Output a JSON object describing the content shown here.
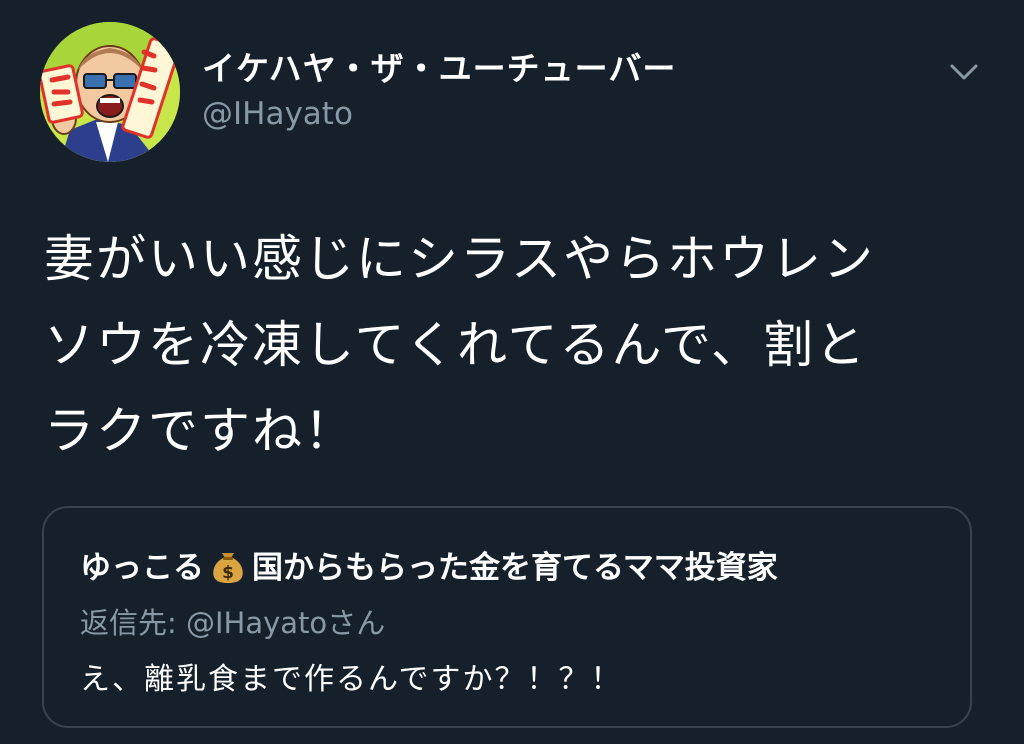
{
  "author": {
    "display_name": "イケハヤ・ザ・ユーチューバー",
    "username": "@IHayato",
    "avatar_text": "イケハヤ大学"
  },
  "tweet": {
    "text": "妻がいい感じにシラスやらホウレン\nソウを冷凍してくれてるんで、割と\nラクですね！"
  },
  "quoted_tweet": {
    "author_name_part1": "ゆっこる",
    "author_emoji": "money-bag-icon",
    "author_name_part2": "国からもらった金を育てるママ投資家",
    "reply_label": "返信先: ",
    "reply_username": "@IHayato",
    "reply_suffix": "さん",
    "text": "え、離乳食まで作るんですか？！？！"
  },
  "colors": {
    "background": "#15202b",
    "text_primary": "#ffffff",
    "text_secondary": "#8899a6",
    "border": "#38444d",
    "avatar_bg": "#c8e64a",
    "avatar_text_red": "#e0322b"
  }
}
